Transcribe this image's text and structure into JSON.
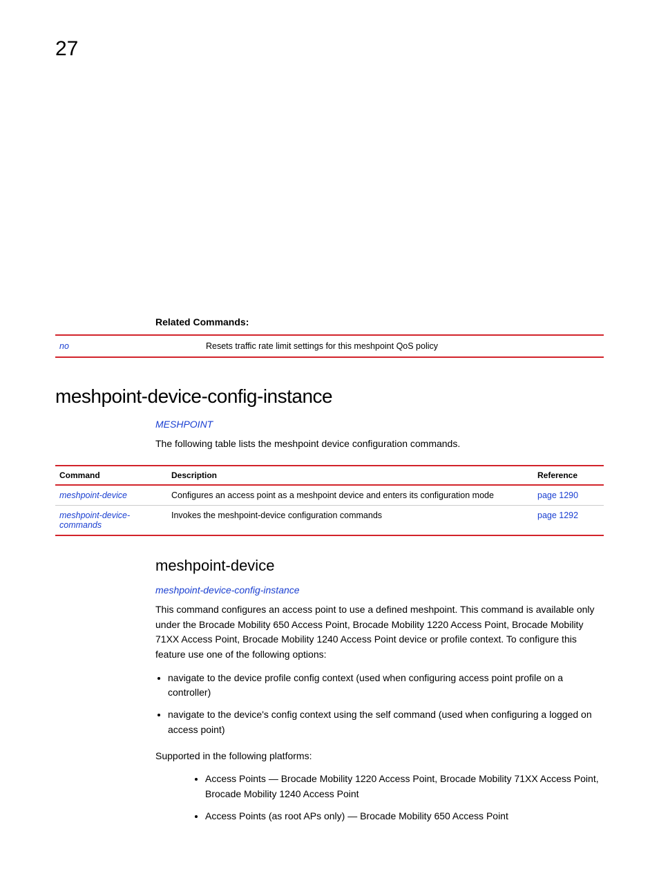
{
  "pageNumber": "27",
  "relatedCommands": {
    "heading": "Related Commands:",
    "rows": [
      {
        "cmd": "no",
        "desc": "Resets traffic rate limit settings for this meshpoint QoS policy"
      }
    ]
  },
  "mainHeading": "meshpoint-device-config-instance",
  "mainBreadcrumb": "MESHPOINT",
  "mainIntro": "The following table lists the meshpoint device configuration commands.",
  "cmdTable": {
    "headers": {
      "cmd": "Command",
      "desc": "Description",
      "ref": "Reference"
    },
    "rows": [
      {
        "cmd": "meshpoint-device",
        "desc": "Configures an access point as a meshpoint device and enters its configuration mode",
        "ref": "page 1290"
      },
      {
        "cmd": "meshpoint-device-commands",
        "desc": "Invokes the meshpoint-device configuration commands",
        "ref": "page 1292"
      }
    ]
  },
  "subSection": {
    "heading": "meshpoint-device",
    "breadcrumb": "meshpoint-device-config-instance",
    "para1": "This command configures an access point to use a defined meshpoint. This command is available only under the Brocade Mobility 650 Access Point, Brocade Mobility 1220 Access Point, Brocade Mobility 71XX Access Point, Brocade Mobility 1240 Access Point device or profile context. To configure this feature use one of the following options:",
    "bullets1": [
      "navigate to the device profile config context (used when configuring access point profile on a controller)",
      "navigate to the device's config context using the self command (used when configuring a logged on access point)"
    ],
    "supportedHeading": "Supported in the following platforms:",
    "bullets2": [
      "Access Points — Brocade Mobility 1220 Access Point, Brocade Mobility 71XX Access Point, Brocade Mobility 1240 Access Point",
      "Access Points (as root APs only) — Brocade Mobility 650 Access Point"
    ]
  }
}
